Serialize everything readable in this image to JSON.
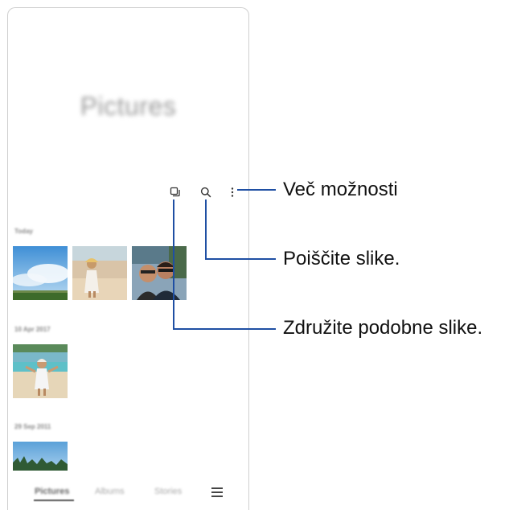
{
  "app": {
    "title": "Pictures"
  },
  "toolbar": {
    "icons": [
      "group-similar-icon",
      "search-icon",
      "more-options-icon"
    ]
  },
  "sections": [
    {
      "label": "Today"
    },
    {
      "label": "10 Apr 2017"
    },
    {
      "label": "29 Sep 2011"
    }
  ],
  "bottom_nav": {
    "tabs": [
      {
        "label": "Pictures",
        "active": true
      },
      {
        "label": "Albums",
        "active": false
      },
      {
        "label": "Stories",
        "active": false
      }
    ],
    "menu_icon": "hamburger-menu-icon"
  },
  "callouts": {
    "more_options": "Več možnosti",
    "search": "Poiščite slike.",
    "group_similar": "Združite podobne slike."
  },
  "colors": {
    "callout_line": "#1f4fa3",
    "text": "#111111"
  }
}
